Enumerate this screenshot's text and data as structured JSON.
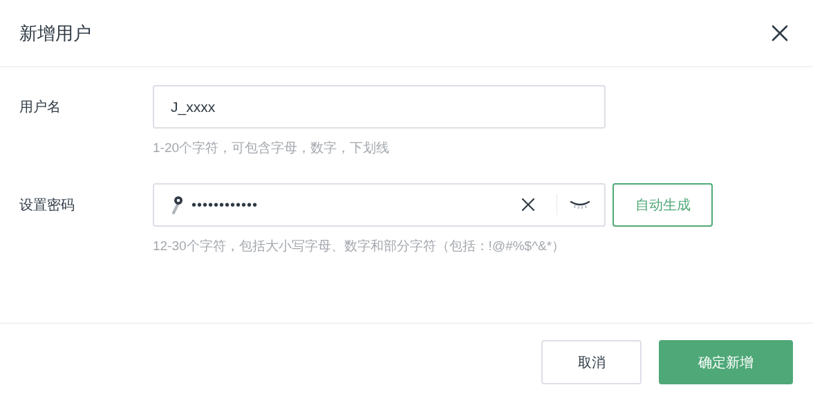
{
  "dialog": {
    "title": "新增用户"
  },
  "fields": [
    {
      "kind": "text",
      "label": "用户名",
      "value": "J_xxxx",
      "hint": "1-20个字符，可包含字母，数字，下划线"
    },
    {
      "kind": "password",
      "label": "设置密码",
      "value": "••••••••••••",
      "hint": "12-30个字符，包括大小写字母、数字和部分字符（包括：!@#%$^&*）",
      "action": "自动生成"
    }
  ],
  "buttons": [
    {
      "label": "取消",
      "kind": "secondary"
    },
    {
      "label": "确定新增",
      "kind": "primary"
    }
  ]
}
